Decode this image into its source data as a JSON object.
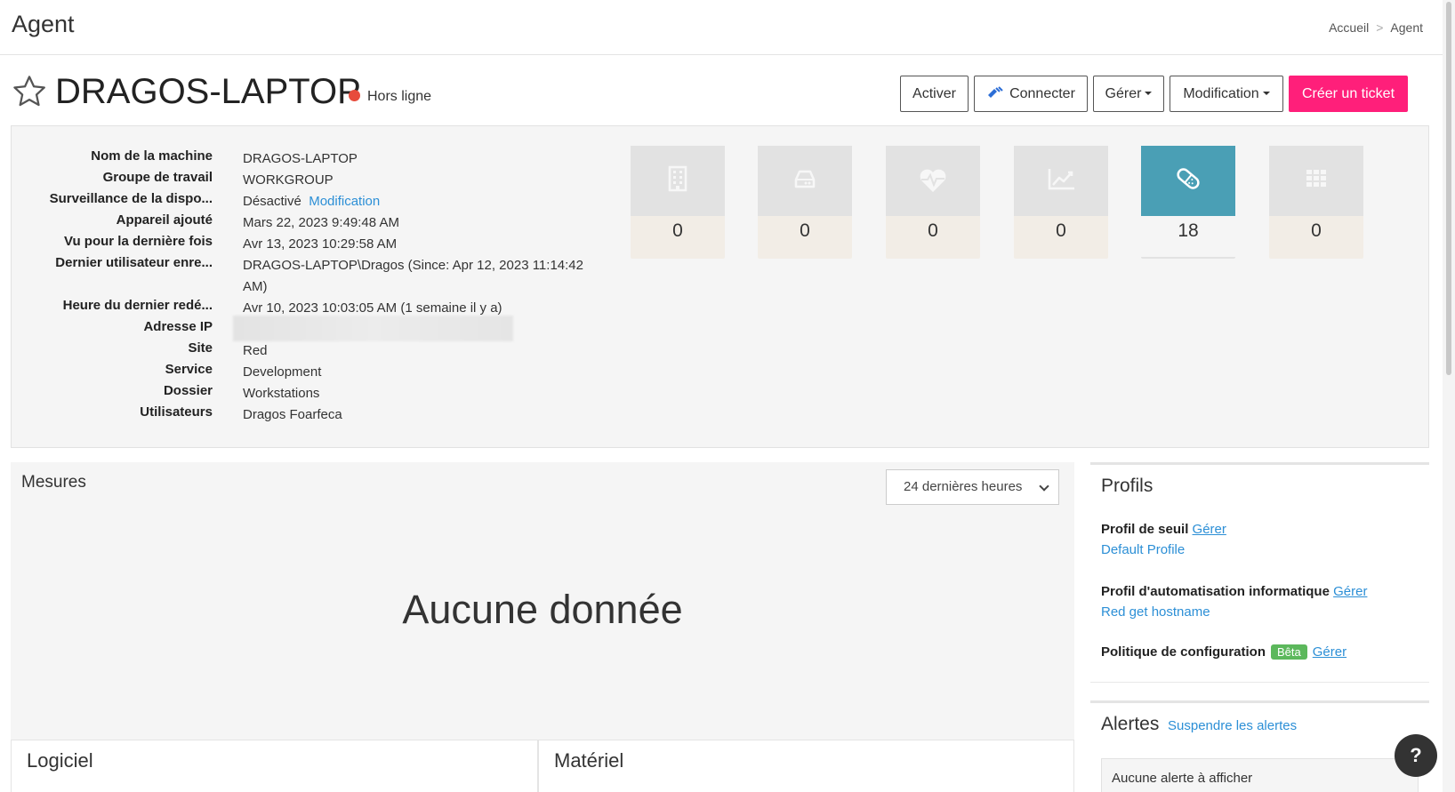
{
  "page": {
    "title": "Agent"
  },
  "breadcrumb": {
    "home": "Accueil",
    "separator": ">",
    "current": "Agent"
  },
  "device": {
    "name": "DRAGOS-LAPTOP",
    "status": "Hors ligne",
    "status_color": "#e74c3c"
  },
  "actions": {
    "activate": "Activer",
    "connect": "Connecter",
    "manage": "Gérer",
    "edit": "Modification",
    "create_ticket": "Créer un ticket",
    "primary_color": "#ff1f7a"
  },
  "info": [
    {
      "label": "Nom de la machine",
      "value": "DRAGOS-LAPTOP"
    },
    {
      "label": "Groupe de travail",
      "value": "WORKGROUP"
    },
    {
      "label": "Surveillance de la dispo...",
      "value": "Désactivé",
      "link": "Modification"
    },
    {
      "label": "Appareil ajouté",
      "value": "Mars 22, 2023 9:49:48 AM"
    },
    {
      "label": "Vu pour la dernière fois",
      "value": "Avr 13, 2023 10:29:58 AM"
    },
    {
      "label": "Dernier utilisateur enre...",
      "value": "DRAGOS-LAPTOP\\Dragos (Since: Apr 12, 2023 11:14:42 AM)"
    },
    {
      "label": "Heure du dernier redé...",
      "value": "Avr 10, 2023 10:03:05 AM (1 semaine il y a)"
    },
    {
      "label": "Adresse IP",
      "value": ""
    },
    {
      "label": "Site",
      "value": "Red"
    },
    {
      "label": "Service",
      "value": "Development"
    },
    {
      "label": "Dossier",
      "value": "Workstations"
    },
    {
      "label": "Utilisateurs",
      "value": "Dragos Foarfeca"
    }
  ],
  "tiles": [
    {
      "icon": "building-icon",
      "count": "0"
    },
    {
      "icon": "hard-drive-icon",
      "count": "0"
    },
    {
      "icon": "heartbeat-icon",
      "count": "0"
    },
    {
      "icon": "trend-chart-icon",
      "count": "0"
    },
    {
      "icon": "patch-bandage-icon",
      "count": "18"
    },
    {
      "icon": "apps-grid-icon",
      "count": "0"
    }
  ],
  "measures": {
    "title": "Mesures",
    "range": "24 dernières heures",
    "empty": "Aucune donnée"
  },
  "profiles": {
    "title": "Profils",
    "threshold_label": "Profil de seuil",
    "threshold_manage": "Gérer",
    "threshold_value": "Default Profile",
    "automation_label": "Profil d'automatisation informatique",
    "automation_manage": "Gérer",
    "automation_value": "Red get hostname",
    "config_label": "Politique de configuration",
    "config_badge": "Bêta",
    "config_manage": "Gérer"
  },
  "alerts": {
    "title": "Alertes",
    "suspend": "Suspendre les alertes",
    "empty": "Aucune alerte à afficher"
  },
  "bottom": {
    "software": "Logiciel",
    "hardware": "Matériel"
  },
  "help": "?"
}
